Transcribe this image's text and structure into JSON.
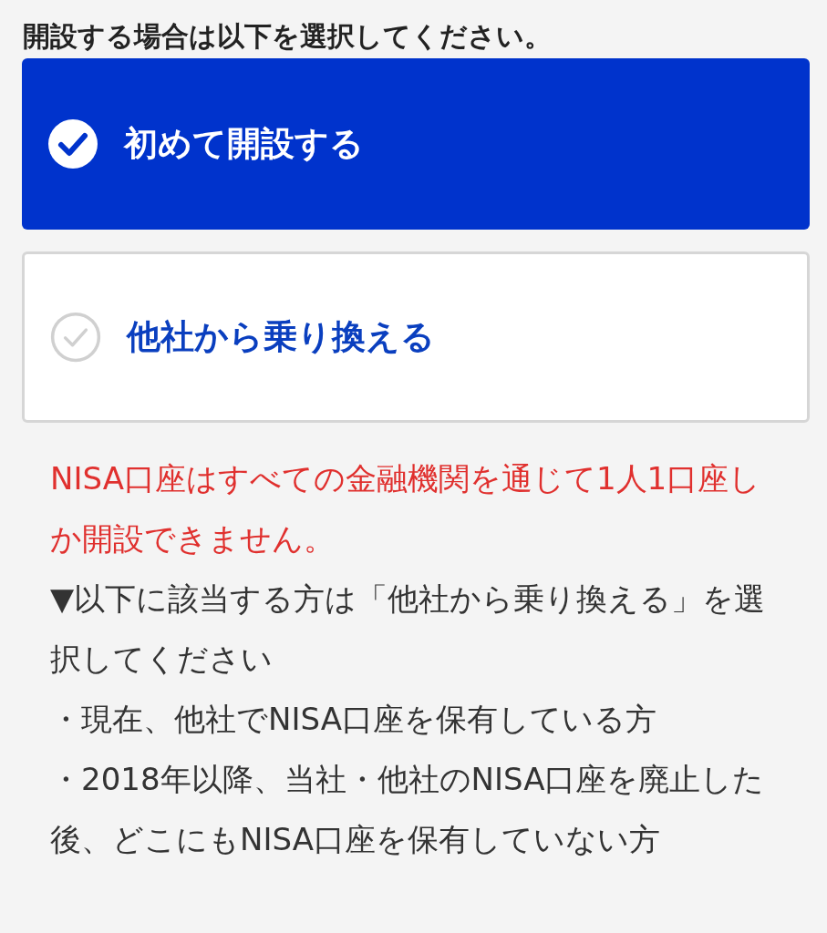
{
  "heading": "開設する場合は以下を選択してください。",
  "options": [
    {
      "label": "初めて開設する",
      "selected": true
    },
    {
      "label": "他社から乗り換える",
      "selected": false
    }
  ],
  "notice": "NISA口座はすべての金融機関を通じて1人1口座しか開設できません。",
  "instruction": "▼以下に該当する方は「他社から乗り換える」を選択してください",
  "bullets": [
    "・現在、他社でNISA口座を保有している方",
    "・2018年以降、当社・他社のNISA口座を廃止した後、どこにもNISA口座を保有していない方"
  ]
}
